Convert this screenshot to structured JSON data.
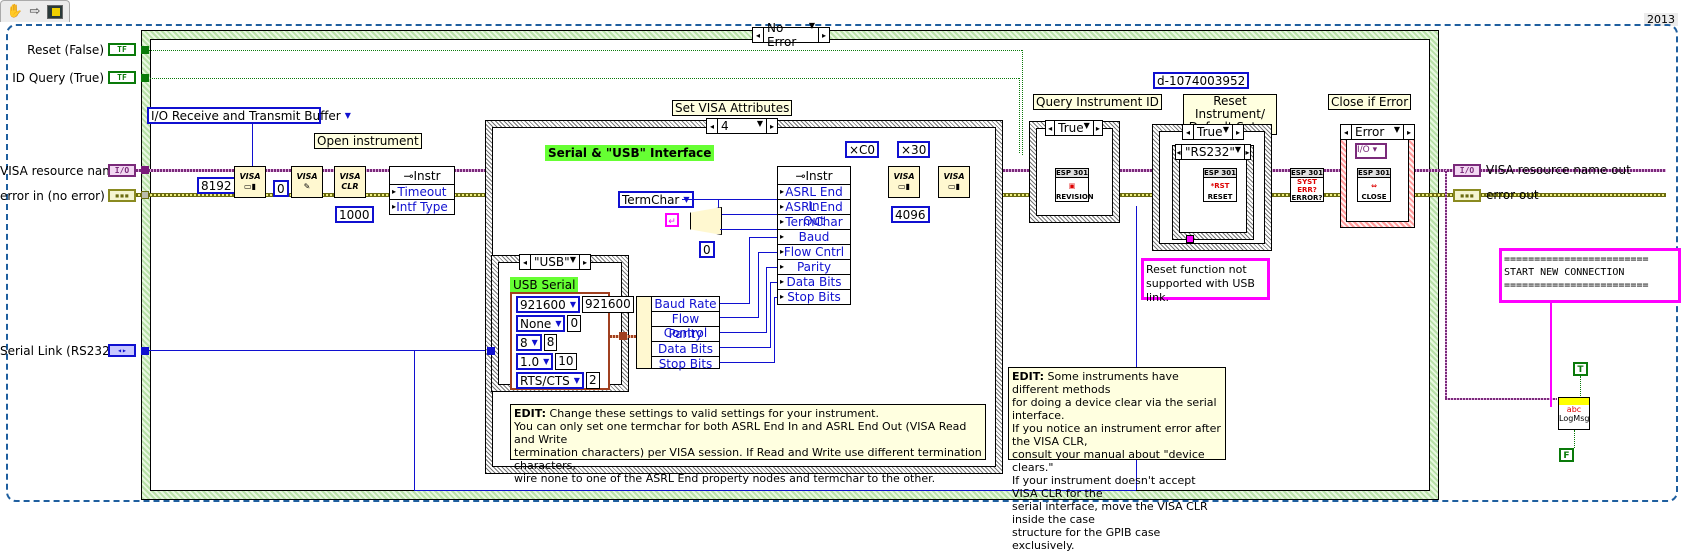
{
  "toolbar": {
    "icons": [
      "hand-tool-icon",
      "arrow-icon",
      "block-diagram-icon"
    ]
  },
  "year_label": "2013",
  "main_case": {
    "selector": "No Error"
  },
  "controls": {
    "reset": {
      "label": "Reset (False)",
      "glyph": "TF"
    },
    "id_query": {
      "label": "ID Query (True)",
      "glyph": "TF"
    },
    "visa_resource": {
      "label": "VISA resource name",
      "glyph": "I/O"
    },
    "error_in": {
      "label": "error in (no error)",
      "glyph": "▪▪▪"
    },
    "serial_link": {
      "label": "Serial Link (RS232)",
      "glyph": "◂▸"
    }
  },
  "indicators": {
    "visa_out": {
      "label": "VISA resource name out",
      "glyph": "I/O"
    },
    "error_out": {
      "label": "error out",
      "glyph": "▪▪▪"
    }
  },
  "buffer_ring": {
    "value": "I/O Receive and Transmit Buffer"
  },
  "open_instrument_label": "Open instrument",
  "const_8192": "8192",
  "const_0": "0",
  "const_1000": "1000",
  "visa_nodes": {
    "set_buffer": "VISA",
    "flush": "VISA",
    "clr": {
      "top": "VISA",
      "mid": "CLR"
    }
  },
  "prop_node1": {
    "header": "Instr",
    "rows": [
      "Timeout",
      "Intf Type"
    ]
  },
  "set_visa_attrs": {
    "title": "Set VISA Attributes",
    "selector": "4",
    "interface_label": "Serial & \"USB\" Interface",
    "termchar_ring": "TermChar",
    "termchar_const": "0",
    "prop_node": {
      "header": "Instr",
      "rows": [
        "ASRL End In",
        "ASRL End Out",
        "TermChar",
        "Baud",
        "Flow Cntrl",
        "Parity",
        "Data Bits",
        "Stop Bits"
      ]
    },
    "usb_case": {
      "selector": "\"USB\"",
      "label": "USB Serial",
      "settings": [
        {
          "ring": "921600",
          "value": "921600"
        },
        {
          "ring": "None",
          "value": "0"
        },
        {
          "ring": "8",
          "value": "8"
        },
        {
          "ring": "1.0",
          "value": "10"
        },
        {
          "ring": "RTS/CTS",
          "value": "2"
        }
      ]
    },
    "unbundle_rows": [
      "Baud Rate",
      "Flow Control",
      "Parity",
      "Data Bits",
      "Stop Bits"
    ],
    "comment": {
      "bold": "EDIT:",
      "lines": [
        " Change these settings to valid settings for your instrument.",
        "You can only set one termchar for both ASRL End In and ASRL End Out (VISA Read and Write",
        "termination characters) per VISA session. If Read and Write use different termination characters,",
        "wire none to one of the ASRL End property nodes and termchar to the other."
      ]
    }
  },
  "consts_right": {
    "xc0": "×C0",
    "x30": "×30",
    "c4096": "4096"
  },
  "query_id": {
    "label": "Query Instrument ID",
    "selector": "True",
    "node": {
      "header": "ESP 301",
      "footer": "REVISION"
    }
  },
  "reset_section": {
    "error_const": "d-1074003952",
    "label_line1": "Reset Instrument/",
    "label_line2": "Default Setup",
    "selector_outer": "True",
    "selector_inner": "\"RS232\"",
    "node": {
      "header": "ESP 301",
      "mid": "*RST",
      "footer": "RESET"
    },
    "note": [
      "Reset function not",
      "supported with USB link."
    ]
  },
  "error_node": {
    "header": "ESP 301",
    "mid": "SYST ERR?",
    "footer": "ERROR?"
  },
  "close_section": {
    "label": "Close if Error",
    "selector": "Error",
    "node": {
      "header": "ESP 301",
      "footer": "CLOSE"
    }
  },
  "clr_comment": {
    "bold": "EDIT:",
    "lines": [
      " Some instruments have different methods",
      "for doing a device clear via the serial interface.",
      "If you notice an instrument error after the VISA CLR,",
      "consult your manual about \"device clears.\"",
      "If your instrument doesn't accept VISA CLR for the",
      "serial interface, move the VISA CLR inside the case",
      "structure for the GPIB case exclusively."
    ]
  },
  "log_string": {
    "lines": [
      "========================",
      "START NEW CONNECTION",
      "========================"
    ]
  },
  "log_msg": {
    "label": "LogMsg",
    "true_const": "T",
    "false_const": "F"
  }
}
